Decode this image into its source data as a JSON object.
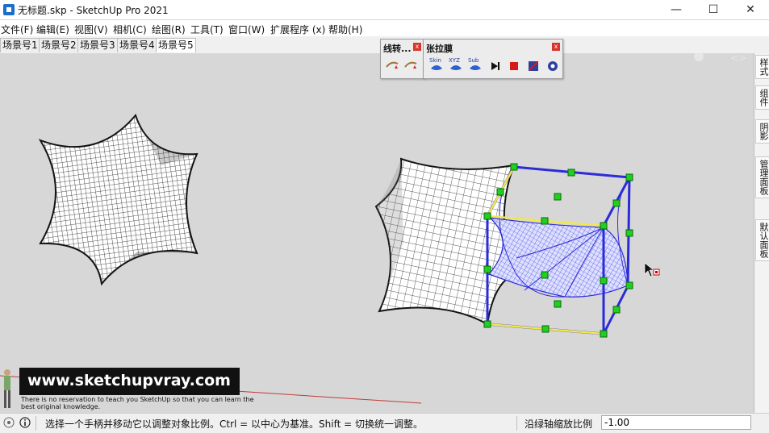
{
  "window": {
    "title": "无标题.skp - SketchUp Pro 2021",
    "minimize": "—",
    "maximize": "☐",
    "close": "✕"
  },
  "menu": [
    "文件(F)",
    "编辑(E)",
    "视图(V)",
    "相机(C)",
    "绘图(R)",
    "工具(T)",
    "窗口(W)",
    "扩展程序 (x)",
    "帮助(H)"
  ],
  "scene_tabs": [
    "场景号1",
    "场景号2",
    "场景号3",
    "场景号4",
    "场景号5"
  ],
  "active_scene": "场景号5",
  "toolbar_1": {
    "title": "线转...",
    "close": "x",
    "icons": [
      "line-convert-icon",
      "line-convert-alt-icon"
    ]
  },
  "toolbar_2": {
    "title": "张拉膜",
    "close": "x",
    "icons": [
      "skin-icon",
      "skin-xyz-icon",
      "skin-sub-icon",
      "play-icon",
      "stop-icon",
      "record-icon",
      "settings-icon"
    ],
    "labels": [
      "Skin",
      "XYZ",
      "Sub"
    ]
  },
  "right_panels": [
    "样式",
    "组件",
    "阴影",
    "管理面板",
    "默认面板"
  ],
  "status": {
    "message": "选择一个手柄并移动它以调整对象比例。Ctrl = 以中心为基准。Shift = 切换统一调整。",
    "vcb_label": "沿绿轴缩放比例",
    "vcb_value": "-1.00"
  },
  "watermark": {
    "site": "www.sketchupvray.com",
    "tagline": "There is no reservation to teach you SketchUp so that you can learn the best original knowledge."
  },
  "colors": {
    "title_bg": "#ffffff",
    "viewport_bg": "#d7d7d7",
    "selection_blue": "#2b2bd8",
    "grip_green": "#1fd01f",
    "axis_red": "#c23a3a"
  }
}
